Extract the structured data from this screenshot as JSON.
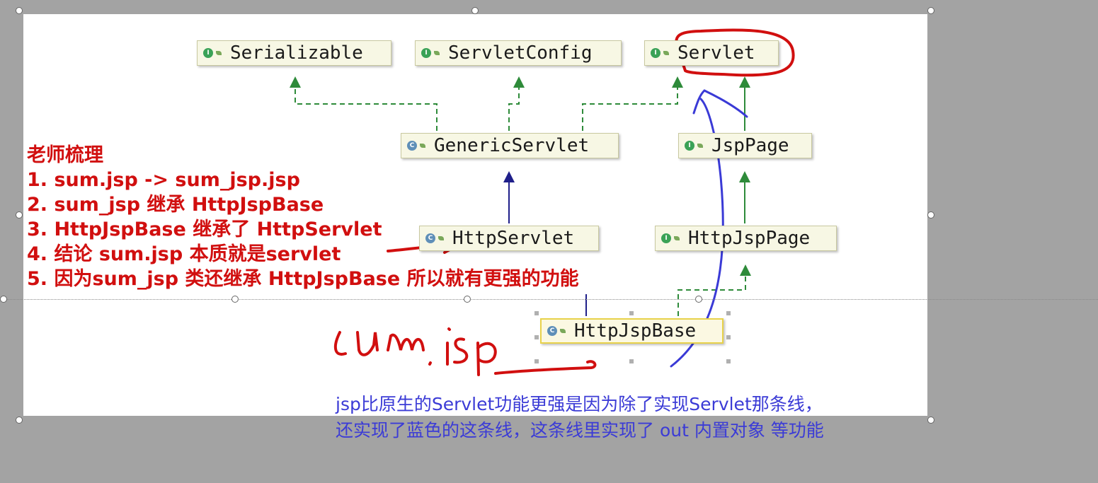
{
  "diagram": {
    "nodes": [
      {
        "id": "serializable",
        "label": "Serializable",
        "kind": "I"
      },
      {
        "id": "servletconfig",
        "label": "ServletConfig",
        "kind": "I"
      },
      {
        "id": "servlet",
        "label": "Servlet",
        "kind": "I"
      },
      {
        "id": "genericservlet",
        "label": "GenericServlet",
        "kind": "C"
      },
      {
        "id": "jsppage",
        "label": "JspPage",
        "kind": "I"
      },
      {
        "id": "httpservlet",
        "label": "HttpServlet",
        "kind": "C"
      },
      {
        "id": "httpjsppage",
        "label": "HttpJspPage",
        "kind": "I"
      },
      {
        "id": "httpjspbase",
        "label": "HttpJspBase",
        "kind": "C"
      }
    ],
    "edges": [
      {
        "from": "genericservlet",
        "to": "serializable",
        "type": "implements"
      },
      {
        "from": "genericservlet",
        "to": "servletconfig",
        "type": "implements"
      },
      {
        "from": "genericservlet",
        "to": "servlet",
        "type": "implements"
      },
      {
        "from": "jsppage",
        "to": "servlet",
        "type": "extends-interface"
      },
      {
        "from": "httpservlet",
        "to": "genericservlet",
        "type": "extends"
      },
      {
        "from": "httpjsppage",
        "to": "jsppage",
        "type": "extends-interface"
      },
      {
        "from": "httpjspbase",
        "to": "httpservlet",
        "type": "extends"
      },
      {
        "from": "httpjspbase",
        "to": "httpjsppage",
        "type": "implements"
      }
    ]
  },
  "notes": {
    "title": "老师梳理",
    "items": [
      "1. sum.jsp -> sum_jsp.jsp",
      "2. sum_jsp 继承 HttpJspBase",
      "3. HttpJspBase 继承了 HttpServlet",
      "4. 结论 sum.jsp 本质就是servlet",
      "5. 因为sum_jsp 类还继承 HttpJspBase 所以就有更强的功能"
    ]
  },
  "caption": {
    "line1": "jsp比原生的Servlet功能更强是因为除了实现Servlet那条线，",
    "line2": "还实现了蓝色的这条线，这条线里实现了 out 内置对象 等功能"
  },
  "handwriting": {
    "text": "sum.jsp"
  },
  "colors": {
    "implements_arrow": "#2e8b3a",
    "extends_arrow": "#1f1f8a",
    "red_annotation": "#d10f0f",
    "blue_annotation": "#3b3bd6",
    "canvas_bg": "#ffffff",
    "outer_bg": "#a3a3a3"
  }
}
